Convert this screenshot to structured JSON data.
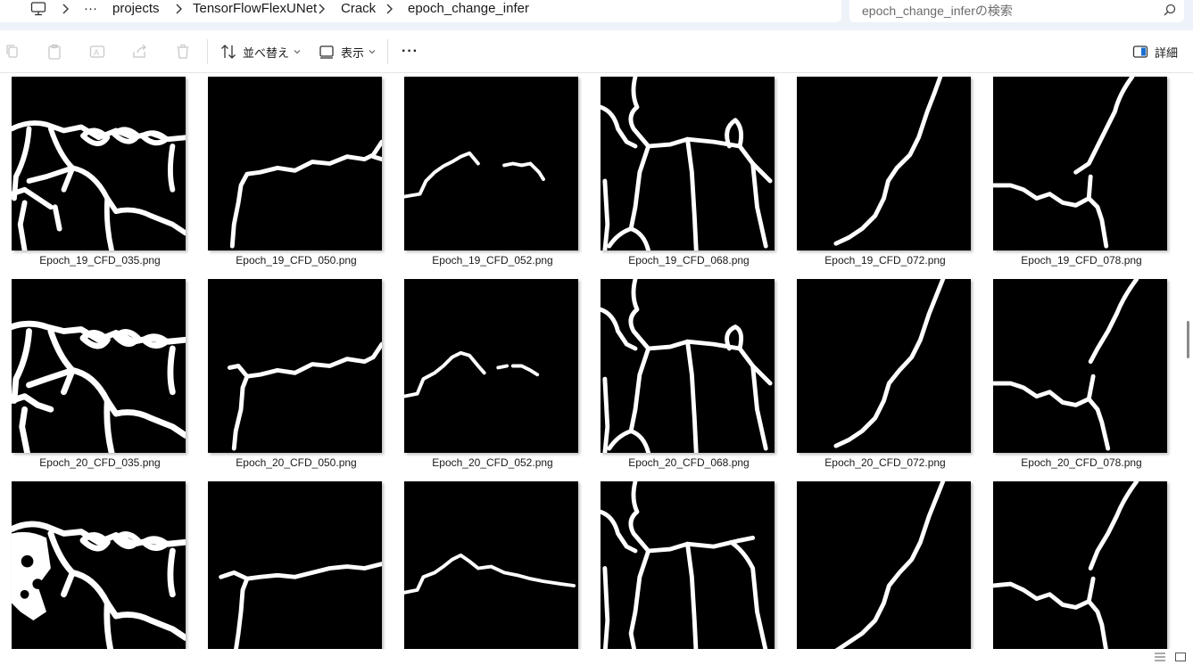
{
  "breadcrumb": {
    "more": "···",
    "items": [
      "projects",
      "TensorFlowFlexUNet",
      "Crack",
      "epoch_change_infer"
    ]
  },
  "search": {
    "placeholder": "epoch_change_inferの検索"
  },
  "toolbar": {
    "sort_label": "並べ替え",
    "view_label": "表示",
    "more_label": "···",
    "details_label": "詳細"
  },
  "files": [
    {
      "name": "Epoch_19_CFD_035.png"
    },
    {
      "name": "Epoch_19_CFD_050.png"
    },
    {
      "name": "Epoch_19_CFD_052.png"
    },
    {
      "name": "Epoch_19_CFD_068.png"
    },
    {
      "name": "Epoch_19_CFD_072.png"
    },
    {
      "name": "Epoch_19_CFD_078.png"
    },
    {
      "name": "Epoch_20_CFD_035.png"
    },
    {
      "name": "Epoch_20_CFD_050.png"
    },
    {
      "name": "Epoch_20_CFD_052.png"
    },
    {
      "name": "Epoch_20_CFD_068.png"
    },
    {
      "name": "Epoch_20_CFD_072.png"
    },
    {
      "name": "Epoch_20_CFD_078.png"
    },
    {
      "name": ""
    },
    {
      "name": ""
    },
    {
      "name": ""
    },
    {
      "name": ""
    },
    {
      "name": ""
    },
    {
      "name": ""
    }
  ]
}
